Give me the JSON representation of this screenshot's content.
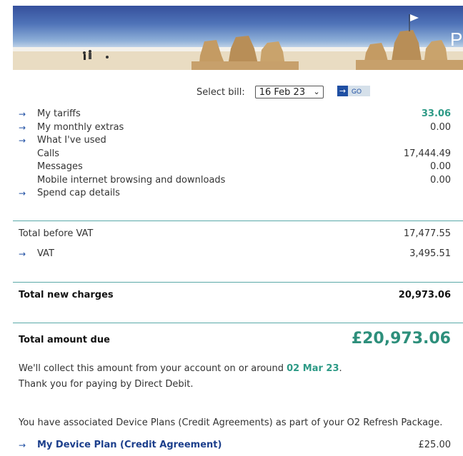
{
  "banner": {
    "text": "P"
  },
  "bill_select": {
    "label": "Select bill:",
    "selected": "16 Feb 23",
    "go_label": "GO"
  },
  "charges": [
    {
      "label": "My tariffs",
      "value": "33.06",
      "arrow": true,
      "highlight": true
    },
    {
      "label": "My monthly extras",
      "value": "0.00",
      "arrow": true
    },
    {
      "label": "What I've used",
      "value": "",
      "arrow": true
    },
    {
      "label": "Calls",
      "value": "17,444.49",
      "arrow": false
    },
    {
      "label": "Messages",
      "value": "0.00",
      "arrow": false
    },
    {
      "label": "Mobile internet browsing and downloads",
      "value": "0.00",
      "arrow": false
    },
    {
      "label": "Spend cap details",
      "value": "",
      "arrow": true
    }
  ],
  "totals": {
    "before_vat_label": "Total before VAT",
    "before_vat_value": "17,477.55",
    "vat_label": "VAT",
    "vat_value": "3,495.51",
    "new_charges_label": "Total new charges",
    "new_charges_value": "20,973.06",
    "amount_due_label": "Total amount due",
    "amount_due_value": "£20,973.06"
  },
  "collection": {
    "text_before": "We'll collect this amount from your account on or around ",
    "date": "02 Mar 23",
    "text_after": ".",
    "thanks": "Thank you for paying by Direct Debit."
  },
  "device_plans": {
    "notice": "You have associated Device Plans (Credit Agreements) as part of your O2 Refresh Package.",
    "plan_label": "My Device Plan (Credit Agreement)",
    "plan_value": "£25.00"
  },
  "colors": {
    "accent": "#2d9a86",
    "link": "#1f4fa3",
    "divider": "#5aa9a8"
  },
  "icons": {
    "row_arrow": "arrow-right-icon",
    "go": "arrow-right-icon",
    "dropdown": "chevron-down-icon"
  }
}
